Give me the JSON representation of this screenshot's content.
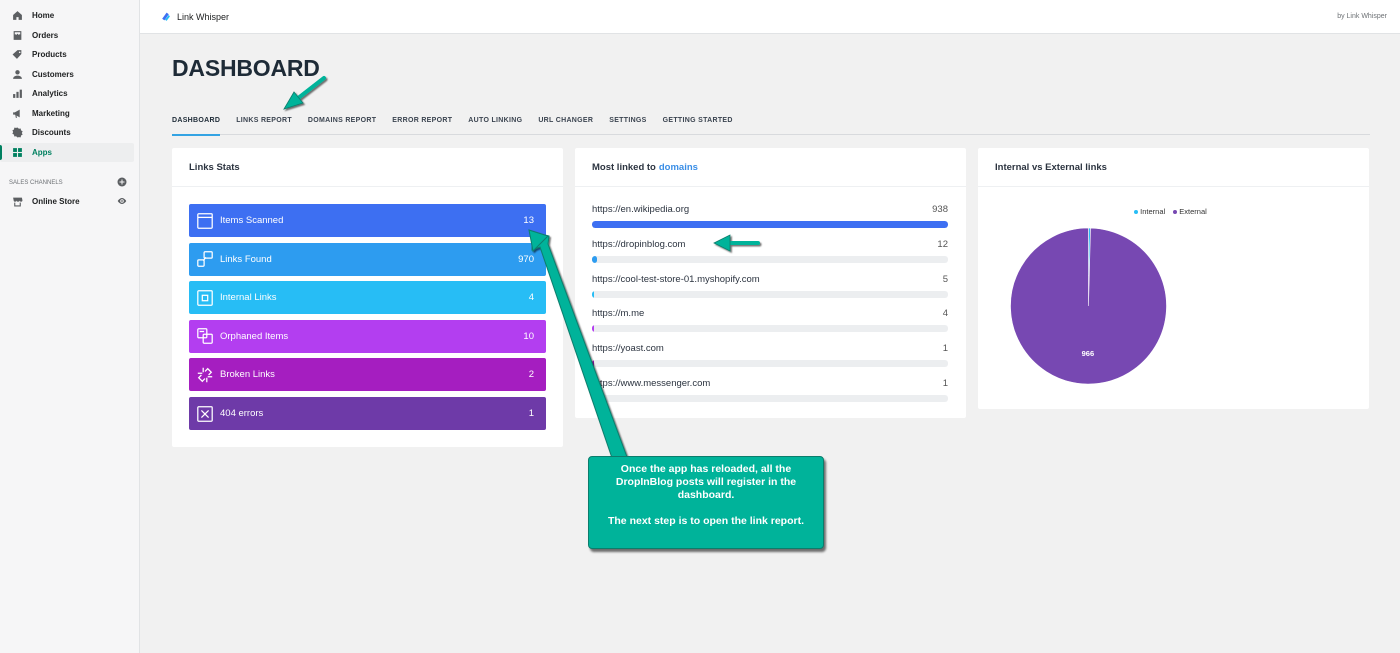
{
  "sidebar": {
    "items": [
      {
        "label": "Home",
        "icon": "home-icon"
      },
      {
        "label": "Orders",
        "icon": "orders-icon"
      },
      {
        "label": "Products",
        "icon": "tag-icon"
      },
      {
        "label": "Customers",
        "icon": "person-icon"
      },
      {
        "label": "Analytics",
        "icon": "bar-chart-icon"
      },
      {
        "label": "Marketing",
        "icon": "megaphone-icon"
      },
      {
        "label": "Discounts",
        "icon": "discount-icon"
      },
      {
        "label": "Apps",
        "icon": "apps-icon",
        "active": true
      }
    ],
    "sales_channels_heading": "SALES CHANNELS",
    "online_store": "Online Store"
  },
  "topbar": {
    "app_name": "Link Whisper",
    "byline": "by Link Whisper"
  },
  "page_title": "DASHBOARD",
  "tabs": [
    "DASHBOARD",
    "LINKS REPORT",
    "DOMAINS REPORT",
    "ERROR REPORT",
    "AUTO LINKING",
    "URL CHANGER",
    "SETTINGS",
    "GETTING STARTED"
  ],
  "links_stats": {
    "title": "Links Stats",
    "items": [
      {
        "label": "Items Scanned",
        "value": "13",
        "color": "#3d6ff2"
      },
      {
        "label": "Links Found",
        "value": "970",
        "color": "#2d9cf0"
      },
      {
        "label": "Internal Links",
        "value": "4",
        "color": "#27bdf5"
      },
      {
        "label": "Orphaned Items",
        "value": "10",
        "color": "#b33ef0"
      },
      {
        "label": "Broken Links",
        "value": "2",
        "color": "#a51ec0"
      },
      {
        "label": "404 errors",
        "value": "1",
        "color": "#6e3aa8"
      }
    ]
  },
  "domains": {
    "title": "Most linked to",
    "title_accent": "domains",
    "items": [
      {
        "domain": "https://en.wikipedia.org",
        "count": "938",
        "fraction": 1.0,
        "color": "#3d6ff2"
      },
      {
        "domain": "https://dropinblog.com",
        "count": "12",
        "fraction": 0.013,
        "color": "#2d9cf0"
      },
      {
        "domain": "https://cool-test-store-01.myshopify.com",
        "count": "5",
        "fraction": 0.005,
        "color": "#27bdf5"
      },
      {
        "domain": "https://m.me",
        "count": "4",
        "fraction": 0.004,
        "color": "#b33ef0"
      },
      {
        "domain": "https://yoast.com",
        "count": "1",
        "fraction": 0.001,
        "color": "#a51ec0"
      },
      {
        "domain": "https://www.messenger.com",
        "count": "1",
        "fraction": 0.001,
        "color": "#6e3aa8"
      }
    ]
  },
  "pie": {
    "title": "Internal vs External links",
    "legend": [
      "Internal",
      "External"
    ],
    "internal_color": "#27bdf5",
    "external_color": "#7748b2"
  },
  "chart_data": {
    "type": "pie",
    "categories": [
      "Internal",
      "External"
    ],
    "values": [
      4,
      966
    ],
    "title": "Internal vs External links",
    "legend": "top"
  },
  "callout": {
    "line1": "Once the app has reloaded, all the DropInBlog posts will register in the dashboard.",
    "line2": "The next step is to open the link report."
  }
}
